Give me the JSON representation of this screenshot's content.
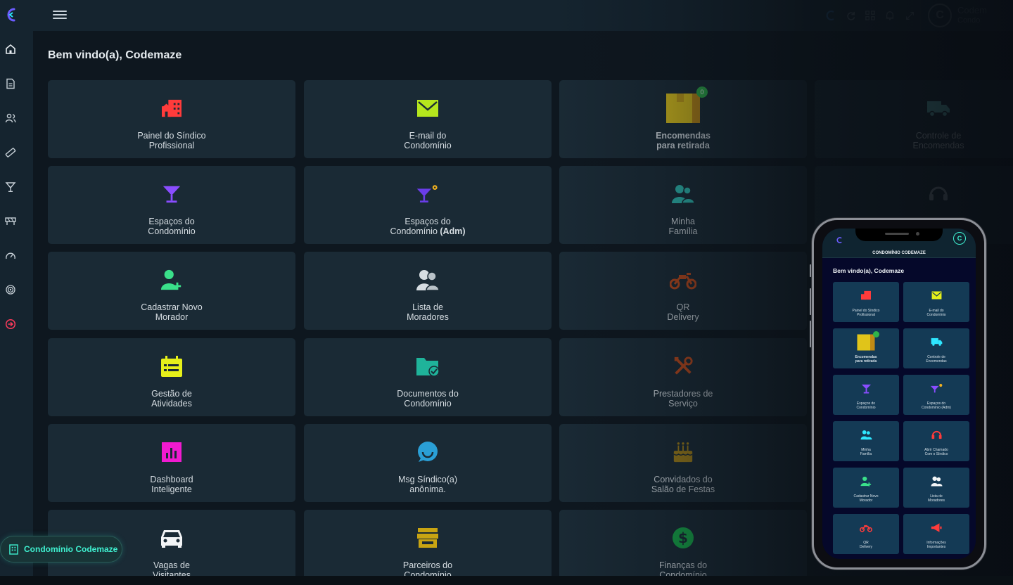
{
  "topbar": {
    "user_name": "Codem",
    "user_sub": "Condo"
  },
  "welcome": "Bem vindo(a), Codemaze",
  "cards": [
    {
      "id": "painel",
      "l1": "Painel do Síndico",
      "l2": "Profissional"
    },
    {
      "id": "email",
      "l1": "E-mail do",
      "l2": "Condomínio"
    },
    {
      "id": "encomendas",
      "l1": "Encomendas",
      "l2": "para retirada",
      "badge": "0"
    },
    {
      "id": "controle",
      "l1": "Controle de",
      "l2": "Encomendas"
    },
    {
      "id": "espacos",
      "l1": "Espaços do",
      "l2": "Condomínio"
    },
    {
      "id": "espacos-adm",
      "l1": "Espaços do",
      "l2": "Condomínio",
      "l2b": "(Adm)"
    },
    {
      "id": "familia",
      "l1": "Minha",
      "l2": "Família"
    },
    {
      "id": "chamado",
      "l1": "",
      "l2": ""
    },
    {
      "id": "cadastrar",
      "l1": "Cadastrar Novo",
      "l2": "Morador"
    },
    {
      "id": "lista",
      "l1": "Lista de",
      "l2": "Moradores"
    },
    {
      "id": "qr",
      "l1": "QR",
      "l2": "Delivery"
    },
    {
      "id": "gestao",
      "l1": "Gestão de",
      "l2": "Atividades"
    },
    {
      "id": "documentos",
      "l1": "Documentos do",
      "l2": "Condomínio"
    },
    {
      "id": "prestadores",
      "l1": "Prestadores de",
      "l2": "Serviço"
    },
    {
      "id": "dashboard",
      "l1": "Dashboard",
      "l2": "Inteligente"
    },
    {
      "id": "msg",
      "l1": "Msg Síndico(a)",
      "l2": "anônima."
    },
    {
      "id": "convidados",
      "l1": "Convidados do",
      "l2": "Salão de Festas"
    },
    {
      "id": "vagas",
      "l1": "Vagas de",
      "l2": "Visitantes"
    },
    {
      "id": "parceiros",
      "l1": "Parceiros do",
      "l2": "Condomínio"
    },
    {
      "id": "financas",
      "l1": "Finanças do",
      "l2": "Condomínio"
    }
  ],
  "pill": "Condomínio Codemaze",
  "phone": {
    "header": "CONDOMÍNIO CODEMAZE",
    "welcome": "Bem vindo(a), Codemaze",
    "cards": [
      {
        "l1": "Painel do Síndico",
        "l2": "Profissional"
      },
      {
        "l1": "E-mail do",
        "l2": "Condomínio"
      },
      {
        "l1": "Encomendas",
        "l2": "para retirada"
      },
      {
        "l1": "Controle de",
        "l2": "Encomendas"
      },
      {
        "l1": "Espaços do",
        "l2": "Condomínio"
      },
      {
        "l1": "Espaços do",
        "l2": "Condomínio (Adm)"
      },
      {
        "l1": "Minha",
        "l2": "Família"
      },
      {
        "l1": "Abrir Chamado",
        "l2": "Com o Síndico"
      },
      {
        "l1": "Cadastrar Novo",
        "l2": "Morador"
      },
      {
        "l1": "Lista de",
        "l2": "Moradores"
      },
      {
        "l1": "QR",
        "l2": "Delivery"
      },
      {
        "l1": "Informações",
        "l2": "Importantes"
      }
    ]
  },
  "colors": {
    "accent": "#3ff0d0",
    "card_bg": "#1a2a35",
    "sidebar_bg": "#15242f",
    "logout": "#ff3b5c"
  }
}
